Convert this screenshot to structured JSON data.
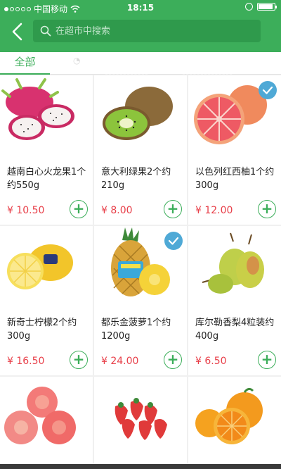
{
  "status_bar": {
    "carrier": "中国移动",
    "time": "18:15"
  },
  "search": {
    "placeholder": "在超市中搜索"
  },
  "tabs": [
    {
      "label": "全部",
      "active": true
    }
  ],
  "products": [
    {
      "name": "越南白心火龙果1个约550g",
      "price": "¥ 10.50",
      "image": "dragon-fruit",
      "selected": false
    },
    {
      "name": "意大利绿果2个约210g",
      "price": "¥ 8.00",
      "image": "kiwi",
      "selected": false
    },
    {
      "name": "以色列红西柚1个约300g",
      "price": "¥ 12.00",
      "image": "grapefruit",
      "selected": true
    },
    {
      "name": "新奇士柠檬2个约300g",
      "price": "¥ 16.50",
      "image": "lemon",
      "selected": false
    },
    {
      "name": "都乐金菠萝1个约1200g",
      "price": "¥ 24.00",
      "image": "pineapple",
      "selected": true
    },
    {
      "name": "库尔勒香梨4粒装约400g",
      "price": "¥ 6.50",
      "image": "pear",
      "selected": false
    },
    {
      "name": "",
      "price": "",
      "image": "apple",
      "selected": false
    },
    {
      "name": "",
      "price": "",
      "image": "strawberry",
      "selected": false
    },
    {
      "name": "",
      "price": "",
      "image": "orange",
      "selected": false
    }
  ],
  "colors": {
    "brand_green": "#3cae5a",
    "price_red": "#e8404a",
    "check_blue": "#4fa9d6"
  }
}
